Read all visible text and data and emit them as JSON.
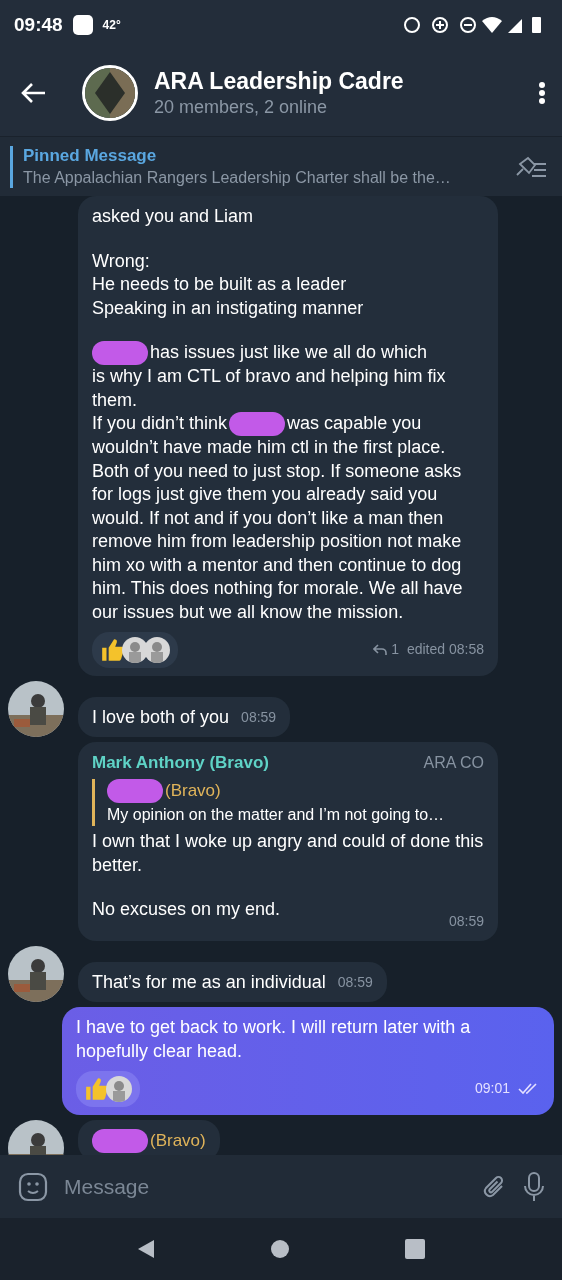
{
  "status_bar": {
    "time": "09:48",
    "temperature": "42°"
  },
  "header": {
    "title": "ARA Leadership Cadre",
    "subtitle": "20 members, 2 online"
  },
  "pinned": {
    "label": "Pinned Message",
    "text": "The Appalachian Rangers Leadership Charter shall be the…"
  },
  "messages": [
    {
      "kind": "incoming",
      "avatar": false,
      "paragraphs": [
        [
          [
            {
              "kind": "text",
              "text": "asked you and Liam"
            }
          ]
        ],
        [
          [
            {
              "kind": "text",
              "text": "Wrong:\nHe needs to be built as a leader\nSpeaking in an instigating manner"
            }
          ]
        ],
        [
          [
            {
              "kind": "redaction"
            },
            {
              "kind": "text",
              "text": "has issues just like we all do which"
            }
          ],
          [
            {
              "kind": "text",
              "text": "is why I am CTL of bravo and helping him fix them."
            }
          ],
          [
            {
              "kind": "text",
              "text": "If you didn’t think"
            },
            {
              "kind": "redaction"
            },
            {
              "kind": "text",
              "text": "was capable you"
            }
          ],
          [
            {
              "kind": "text",
              "text": "wouldn’t have made him ctl in the first place. Both of you need to just stop. If someone asks for logs just give them you already said you would. If not and if you don’t like a man then remove him from leadership position not make him xo with a mentor and then continue to dog him. This does nothing for morale. We all have our issues but we all know the mission."
            }
          ]
        ]
      ],
      "reactions": [
        {
          "kind": "thumb"
        },
        {
          "kind": "avatar"
        },
        {
          "kind": "avatar"
        }
      ],
      "replies": "1",
      "time": "edited 08:58"
    },
    {
      "kind": "incoming",
      "avatar": true,
      "paragraphs": [
        [
          [
            {
              "kind": "text",
              "text": "I love both of you"
            }
          ]
        ]
      ],
      "time": "08:59"
    },
    {
      "kind": "incoming",
      "avatar": false,
      "sender": {
        "name": "Mark Anthony (Bravo)",
        "color": "#5fd3c6",
        "badge": "ARA CO"
      },
      "reply": {
        "sender": [
          {
            "kind": "redaction"
          },
          {
            "kind": "text",
            "text": "(Bravo)"
          }
        ],
        "text": "My opinion on the matter and I’m not going to…"
      },
      "paragraphs": [
        [
          [
            {
              "kind": "text",
              "text": "I own that I woke up angry and could of done this better."
            }
          ]
        ],
        [
          [
            {
              "kind": "text",
              "text": "No excuses on my end."
            }
          ]
        ]
      ],
      "time": "08:59"
    },
    {
      "kind": "incoming",
      "avatar": true,
      "paragraphs": [
        [
          [
            {
              "kind": "text",
              "text": "That’s for me as an individual"
            }
          ]
        ]
      ],
      "time": "08:59"
    },
    {
      "kind": "outgoing",
      "avatar": false,
      "paragraphs": [
        [
          [
            {
              "kind": "text",
              "text": "I have to get back to work. I will return later with a hopefully clear head."
            }
          ]
        ]
      ],
      "reactions": [
        {
          "kind": "thumb"
        },
        {
          "kind": "avatar"
        }
      ],
      "time": "09:01",
      "read": true
    },
    {
      "kind": "incoming",
      "avatar": true,
      "sender_parts": [
        {
          "kind": "redaction"
        },
        {
          "kind": "text",
          "text": "(Bravo)"
        }
      ]
    }
  ],
  "composer": {
    "placeholder": "Message"
  }
}
